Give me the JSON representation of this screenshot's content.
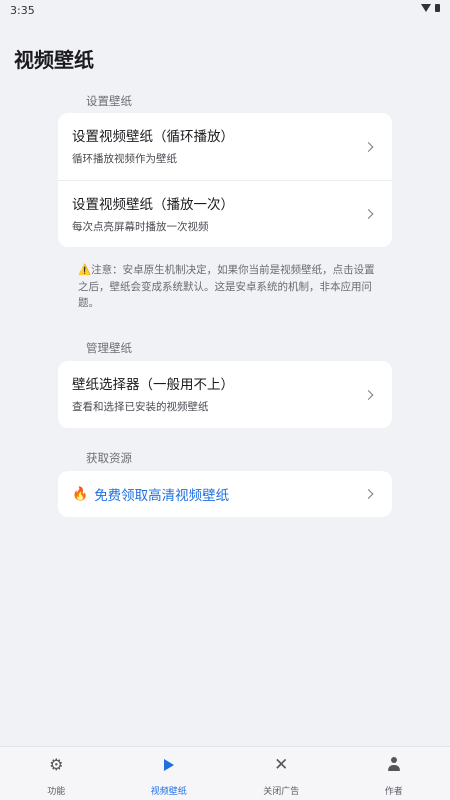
{
  "status_bar": {
    "time": "3:35"
  },
  "page_title": "视频壁纸",
  "sections": {
    "set": {
      "label": "设置壁纸",
      "items": [
        {
          "title": "设置视频壁纸（循环播放）",
          "subtitle": "循环播放视频作为壁纸"
        },
        {
          "title": "设置视频壁纸（播放一次）",
          "subtitle": "每次点亮屏幕时播放一次视频"
        }
      ],
      "note_icon": "⚠️",
      "note": "注意：安卓原生机制决定，如果你当前是视频壁纸，点击设置之后，壁纸会变成系统默认。这是安卓系统的机制，非本应用问题。"
    },
    "manage": {
      "label": "管理壁纸",
      "items": [
        {
          "title": "壁纸选择器（一般用不上）",
          "subtitle": "查看和选择已安装的视频壁纸"
        }
      ]
    },
    "resources": {
      "label": "获取资源",
      "link_icon": "🔥",
      "link": "免费领取高清视频壁纸"
    }
  },
  "bottom_nav": {
    "items": [
      {
        "label": "功能",
        "icon": "gear-icon"
      },
      {
        "label": "视频壁纸",
        "icon": "play-icon",
        "active": true
      },
      {
        "label": "关闭广告",
        "icon": "close-icon"
      },
      {
        "label": "作者",
        "icon": "person-icon"
      }
    ]
  },
  "colors": {
    "accent": "#1e6fe0",
    "background": "#f1f2f6",
    "card": "#ffffff"
  }
}
